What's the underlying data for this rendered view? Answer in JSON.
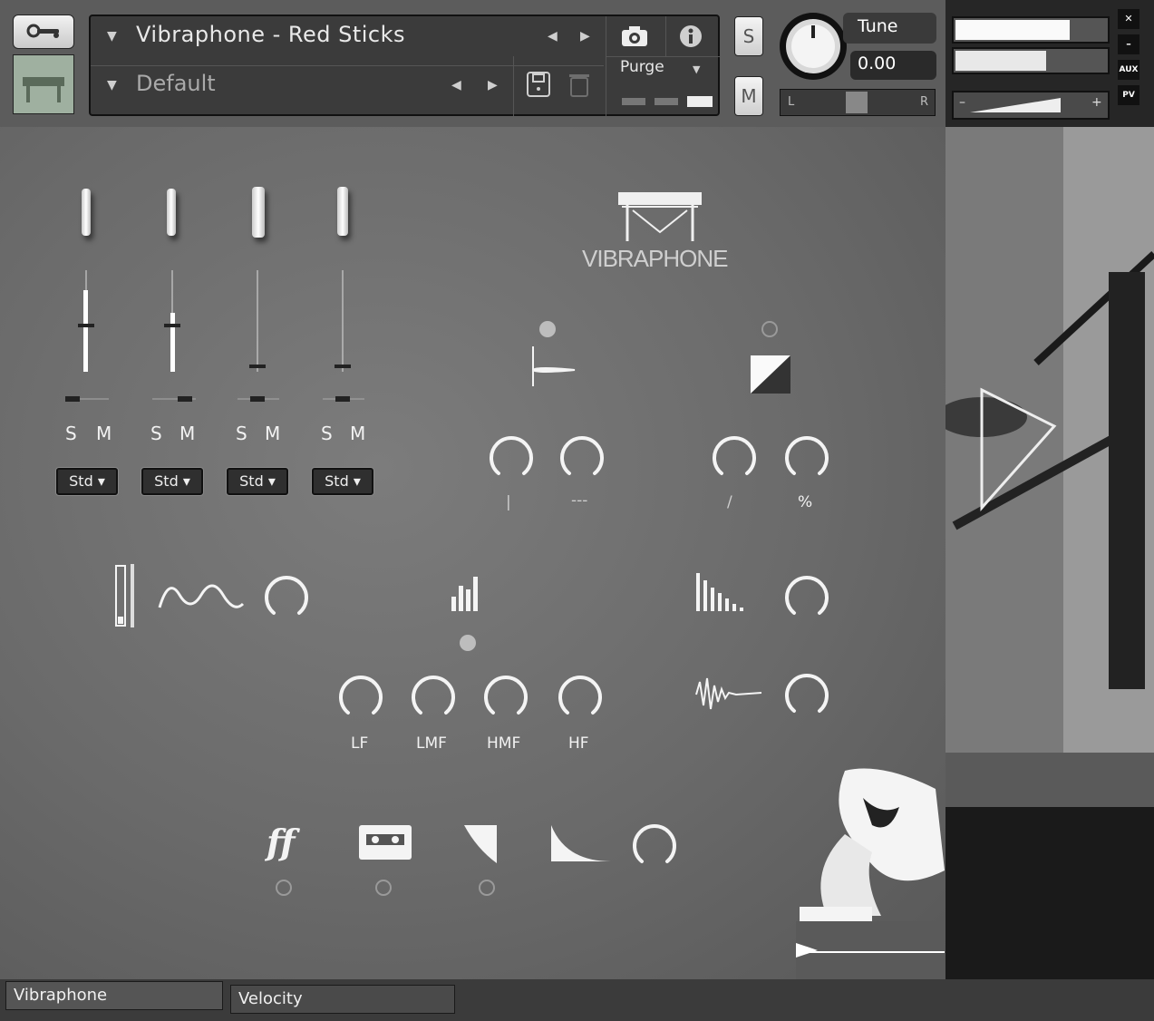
{
  "header": {
    "instrument_name": "Vibraphone - Red Sticks",
    "preset_name": "Default",
    "purge_label": "Purge",
    "solo_label": "S",
    "mute_label": "M",
    "tune_label": "Tune",
    "tune_value": "0.00",
    "pan_left": "L",
    "pan_right": "R",
    "aux_label": "AUX",
    "pv_label": "PV",
    "close_glyph": "✕",
    "minimize_glyph": "–",
    "vol_minus": "–",
    "vol_plus": "+"
  },
  "mixer": {
    "channels": [
      {
        "solo": "S",
        "mute": "M",
        "mode": "Std ▾"
      },
      {
        "solo": "S",
        "mute": "M",
        "mode": "Std ▾"
      },
      {
        "solo": "S",
        "mute": "M",
        "mode": "Std ▾"
      },
      {
        "solo": "S",
        "mute": "M",
        "mode": "Std ▾"
      }
    ]
  },
  "logo_text": "VIBRAPHONE",
  "effects": {
    "reverb_labels": {
      "a": "|",
      "b": "---"
    },
    "transient_labels": {
      "a": "/",
      "b": "%"
    }
  },
  "eq": {
    "bands": [
      "LF",
      "LMF",
      "HMF",
      "HF"
    ]
  },
  "tabs": {
    "tab1": "Vibraphone",
    "tab2": "Velocity"
  }
}
